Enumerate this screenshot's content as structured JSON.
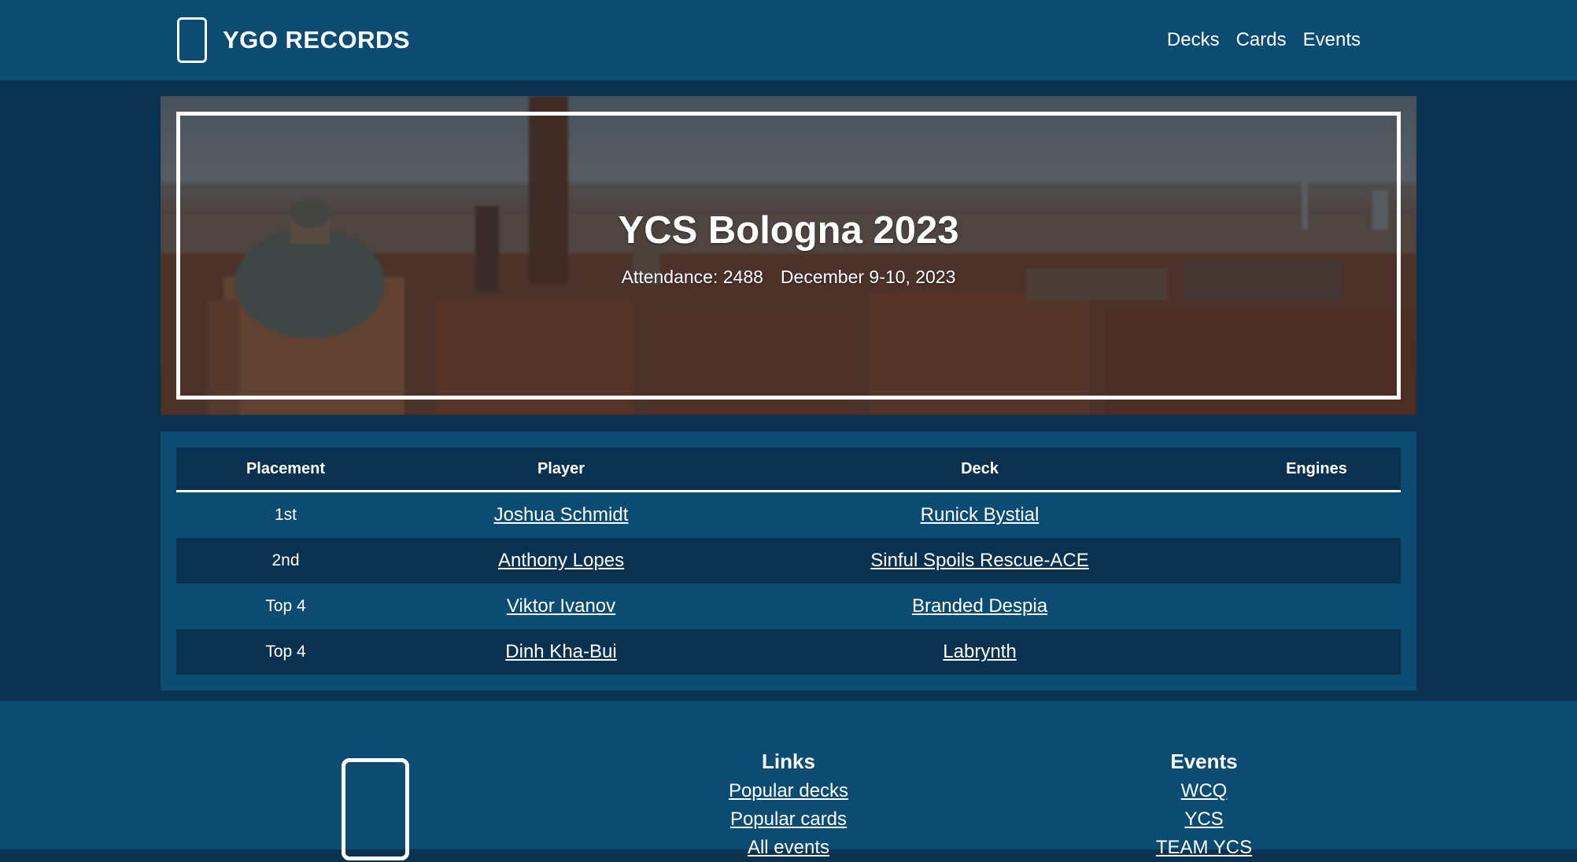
{
  "header": {
    "brand_title": "YGO RECORDS",
    "nav": [
      "Decks",
      "Cards",
      "Events"
    ]
  },
  "event": {
    "title": "YCS Bologna 2023",
    "attendance": "Attendance: 2488",
    "dates": "December 9-10, 2023"
  },
  "results": {
    "columns": [
      "Placement",
      "Player",
      "Deck",
      "Engines"
    ],
    "rows": [
      {
        "placement": "1st",
        "player": "Joshua Schmidt",
        "deck": "Runick Bystial",
        "engines": ""
      },
      {
        "placement": "2nd",
        "player": "Anthony Lopes",
        "deck": "Sinful Spoils Rescue-ACE",
        "engines": ""
      },
      {
        "placement": "Top 4",
        "player": "Viktor Ivanov",
        "deck": "Branded Despia",
        "engines": ""
      },
      {
        "placement": "Top 4",
        "player": "Dinh Kha-Bui",
        "deck": "Labrynth",
        "engines": ""
      }
    ]
  },
  "footer": {
    "links_heading": "Links",
    "links": [
      "Popular decks",
      "Popular cards",
      "All events"
    ],
    "events_heading": "Events",
    "events": [
      "WCQ",
      "YCS",
      "TEAM YCS"
    ]
  },
  "icons": {
    "logo": "crescent-moon-card-icon"
  },
  "colors": {
    "header_bg": "#0d4c72",
    "page_bg": "#0b3150",
    "row_alt_bg": "#0b3150",
    "text": "#ffffff"
  }
}
